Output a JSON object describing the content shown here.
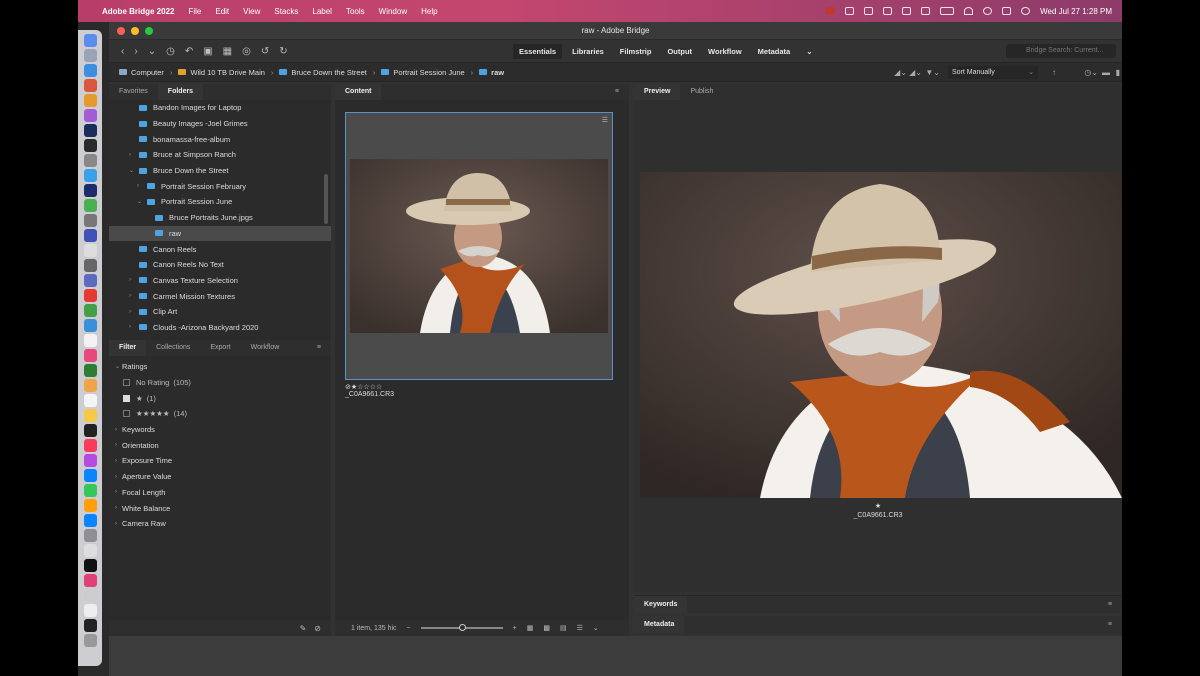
{
  "menubar": {
    "app_name": "Adobe Bridge 2022",
    "items": [
      "File",
      "Edit",
      "View",
      "Stacks",
      "Label",
      "Tools",
      "Window",
      "Help"
    ],
    "clock": "Wed Jul 27  1:28 PM"
  },
  "window": {
    "title": "raw - Adobe Bridge"
  },
  "toolbar": {
    "workspaces": [
      "Essentials",
      "Libraries",
      "Filmstrip",
      "Output",
      "Workflow",
      "Metadata"
    ],
    "active_workspace": "Essentials",
    "search_placeholder": "Bridge Search: Current..."
  },
  "path": {
    "crumbs": [
      "Computer",
      "Wild 10 TB Drive Main",
      "Bruce Down the Street",
      "Portrait Session June",
      "raw"
    ],
    "sort": "Sort Manually"
  },
  "left_tabs": [
    "Favorites",
    "Folders"
  ],
  "active_left_tab": "Folders",
  "folders": [
    {
      "label": "Bandon Images for Laptop",
      "level": 1,
      "arrow": "",
      "selected": false
    },
    {
      "label": "Beauty Images -Joel Grimes",
      "level": 1,
      "arrow": "",
      "selected": false
    },
    {
      "label": "bonamassa-free-album",
      "level": 1,
      "arrow": "",
      "selected": false
    },
    {
      "label": "Bruce at Simpson Ranch",
      "level": 1,
      "arrow": "›",
      "selected": false
    },
    {
      "label": "Bruce Down the Street",
      "level": 1,
      "arrow": "⌄",
      "selected": false
    },
    {
      "label": "Portrait Session February",
      "level": 2,
      "arrow": "›",
      "selected": false
    },
    {
      "label": "Portrait Session June",
      "level": 2,
      "arrow": "⌄",
      "selected": false
    },
    {
      "label": "Bruce Portraits June.jpgs",
      "level": 3,
      "arrow": "",
      "selected": false
    },
    {
      "label": "raw",
      "level": 3,
      "arrow": "",
      "selected": true
    },
    {
      "label": "Canon Reels",
      "level": 1,
      "arrow": "",
      "selected": false
    },
    {
      "label": "Canon Reels No Text",
      "level": 1,
      "arrow": "",
      "selected": false
    },
    {
      "label": "Canvas Texture Selection",
      "level": 1,
      "arrow": "›",
      "selected": false
    },
    {
      "label": "Carmel Mission Textures",
      "level": 1,
      "arrow": "›",
      "selected": false
    },
    {
      "label": "Clip Art",
      "level": 1,
      "arrow": "›",
      "selected": false
    },
    {
      "label": "Clouds -Arizona Backyard 2020",
      "level": 1,
      "arrow": "›",
      "selected": false
    }
  ],
  "filter_tabs": [
    "Filter",
    "Collections",
    "Export",
    "Workflow"
  ],
  "filters": {
    "ratings_label": "Ratings",
    "ratings": [
      {
        "label": "No Rating",
        "count": "(105)",
        "checked": false
      },
      {
        "label": "★",
        "count": "(1)",
        "checked": true
      },
      {
        "label": "★★★★★",
        "count": "(14)",
        "checked": false
      }
    ],
    "groups": [
      "Keywords",
      "Orientation",
      "Exposure Time",
      "Aperture Value",
      "Focal Length",
      "White Balance",
      "Camera Raw"
    ]
  },
  "content": {
    "tab": "Content",
    "rating_stars": "⊘★☆☆☆☆",
    "filename": "_C0A9661.CR3",
    "footer": "1 item, 135 hic"
  },
  "preview": {
    "tabs": [
      "Preview",
      "Publish"
    ],
    "active_tab": "Preview",
    "star": "★",
    "filename": "_C0A9661.CR3"
  },
  "bottom_panels": {
    "keywords": "Keywords",
    "metadata": "Metadata"
  }
}
